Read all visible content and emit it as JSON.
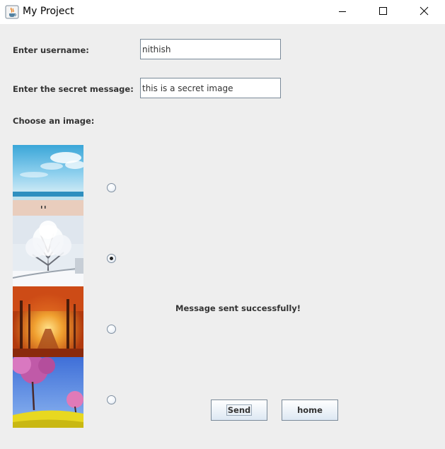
{
  "window": {
    "title": "My Project",
    "controls": [
      "minimize-icon",
      "maximize-icon",
      "close-icon"
    ]
  },
  "form": {
    "username_label": "Enter username:",
    "username_value": "nithish",
    "message_label": "Enter the secret message:",
    "message_value": "this is a secret image",
    "choose_label": "Choose an image:"
  },
  "images": [
    {
      "name": "beach",
      "selected": false
    },
    {
      "name": "snowy-tree",
      "selected": true
    },
    {
      "name": "autumn-forest",
      "selected": false
    },
    {
      "name": "blossom-field",
      "selected": false
    }
  ],
  "status": "Message sent successfully!",
  "buttons": {
    "send_label": "Send",
    "home_label": "home"
  },
  "colors": {
    "background": "#eeeeee",
    "titlebar": "#ffffff",
    "button_gradient_bottom": "#dde8f3",
    "border": "#7a8a99"
  }
}
